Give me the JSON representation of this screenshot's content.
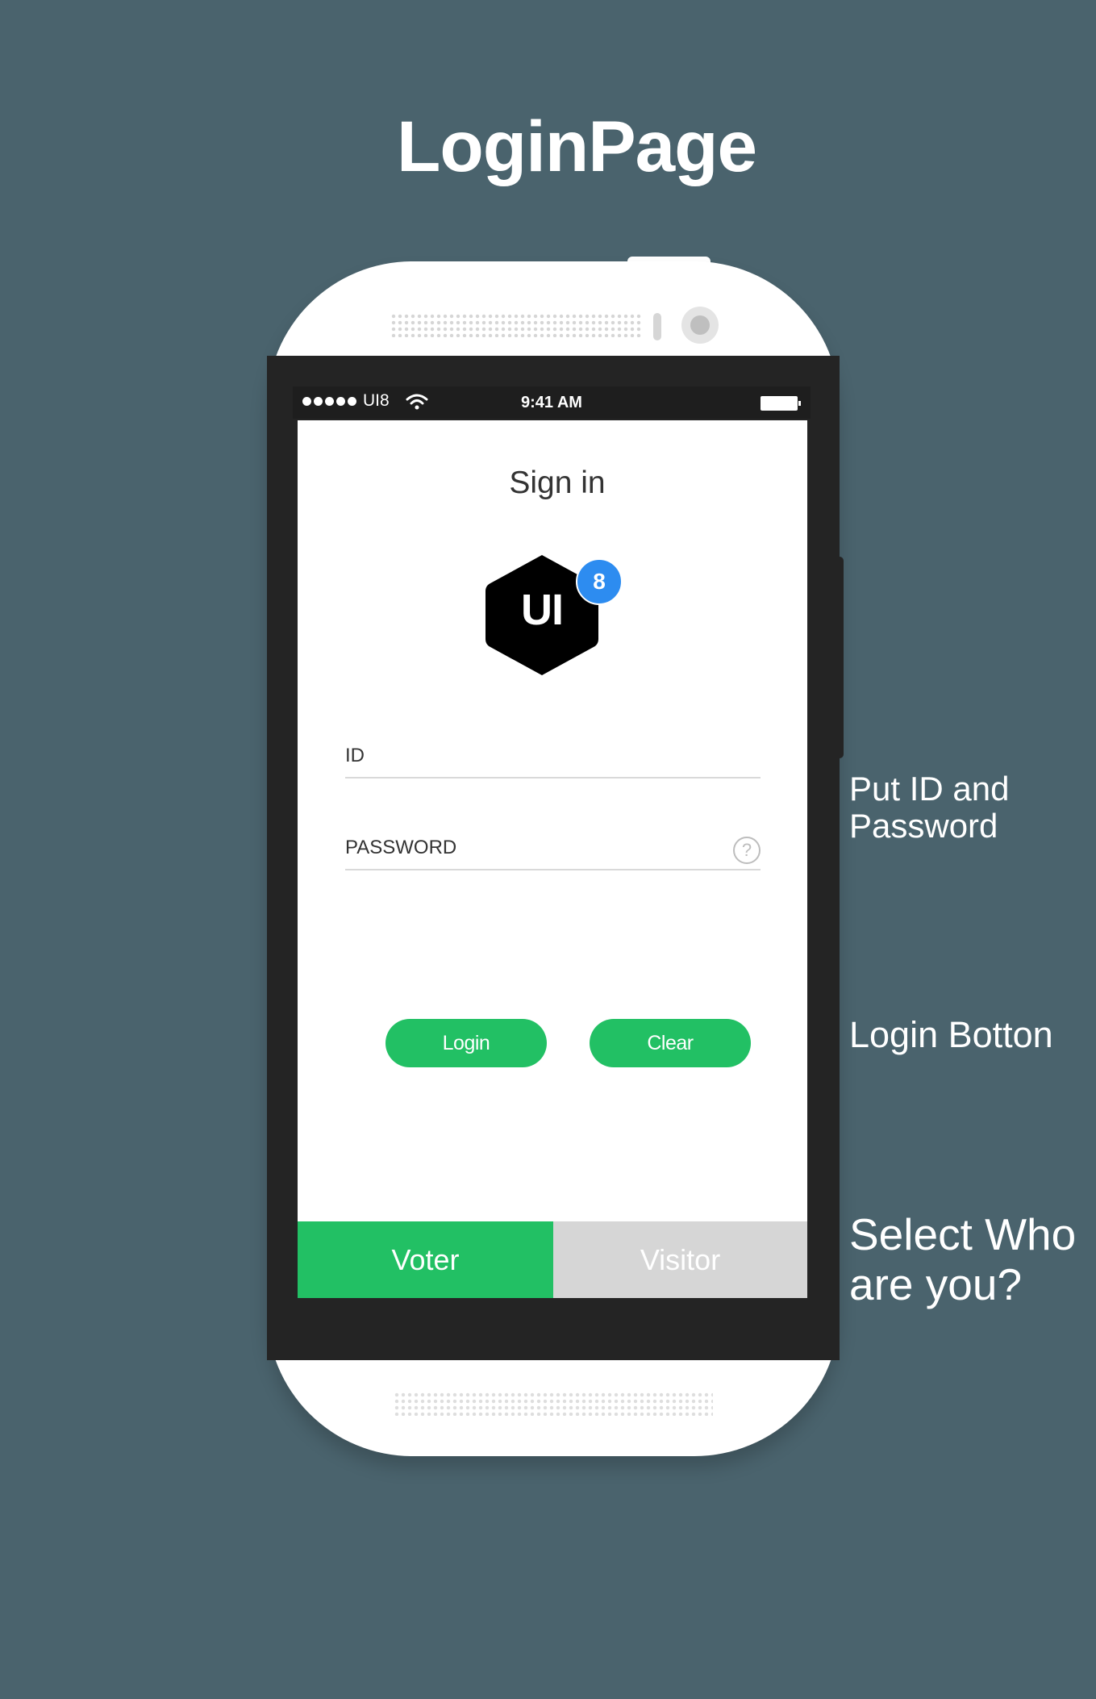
{
  "page": {
    "title": "LoginPage"
  },
  "status_bar": {
    "carrier": "UI8",
    "time": "9:41 AM"
  },
  "screen": {
    "title": "Sign in",
    "logo": {
      "text": "UI",
      "badge": "8"
    },
    "id_field": {
      "label": "ID"
    },
    "password_field": {
      "label": "PASSWORD",
      "help": "?"
    },
    "buttons": {
      "login": "Login",
      "clear": "Clear"
    },
    "roles": {
      "voter": "Voter",
      "visitor": "Visitor"
    }
  },
  "annotations": {
    "credentials": "Put ID and Password",
    "login": "Login Botton",
    "role": "Select Who are you?"
  },
  "colors": {
    "background": "#4a636d",
    "accent_green": "#22c064",
    "badge_blue": "#2d8cf0",
    "inactive_gray": "#d6d6d6",
    "phone_bezel": "#242424"
  }
}
